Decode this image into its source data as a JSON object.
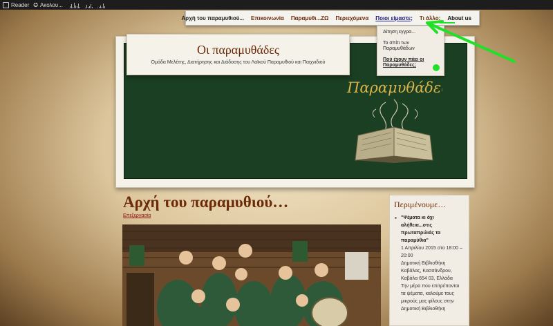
{
  "adminbar": {
    "reader": "Reader",
    "follow": "Ακολου..."
  },
  "nav": {
    "items": [
      {
        "label": "Αρχή του παραμυθιού..."
      },
      {
        "label": "Επικοινωνία"
      },
      {
        "label": "Παραμυθι...ΖΩ"
      },
      {
        "label": "Περιεχόμενα"
      },
      {
        "label": "Ποιοι είμαστε;"
      },
      {
        "label": "Τι άλλο;"
      },
      {
        "label": "About us"
      }
    ],
    "dropdown": [
      {
        "label": "Αίτηση εγγρα..."
      },
      {
        "label": "Το σπίτι των Παραμυθάδων"
      },
      {
        "label": "Πού έχουν πάει οι Παραμυθάδες;"
      }
    ]
  },
  "header": {
    "title": "Οι παραμυθάδες",
    "description": "Ομάδα Μελέτης, Διατήρησης και Διάδοσης του Λαϊκού Παραμυθιού και Παιχνιδιού",
    "logo_text": "Παραμυθάδες"
  },
  "post": {
    "title": "Αρχή του παραμυθιού…",
    "edit_link": "Επεξεργασία"
  },
  "sidebar": {
    "title": "Περιμένουμε…",
    "event": "\"Ψέματα κι όχι αλήθεια...στις πρωταπριλιάς τα παραμύθια\"",
    "date": "1 Απριλίου 2015 στο 18:00 – 20:00",
    "venue": "Δημοτική Βιβλιοθήκη Καβάλας, Κασσάνδρου, Καβάλα 654 03, Ελλάδα",
    "text": "Την μέρα που επιτρέπονται τα ψέματα, καλούμε τους μικρούς μας φίλους στην Δημοτική Βιβλιοθήκη"
  },
  "colors": {
    "accent": "#6b2a08",
    "banner": "#1b3f22",
    "annotation": "#22e02a"
  }
}
